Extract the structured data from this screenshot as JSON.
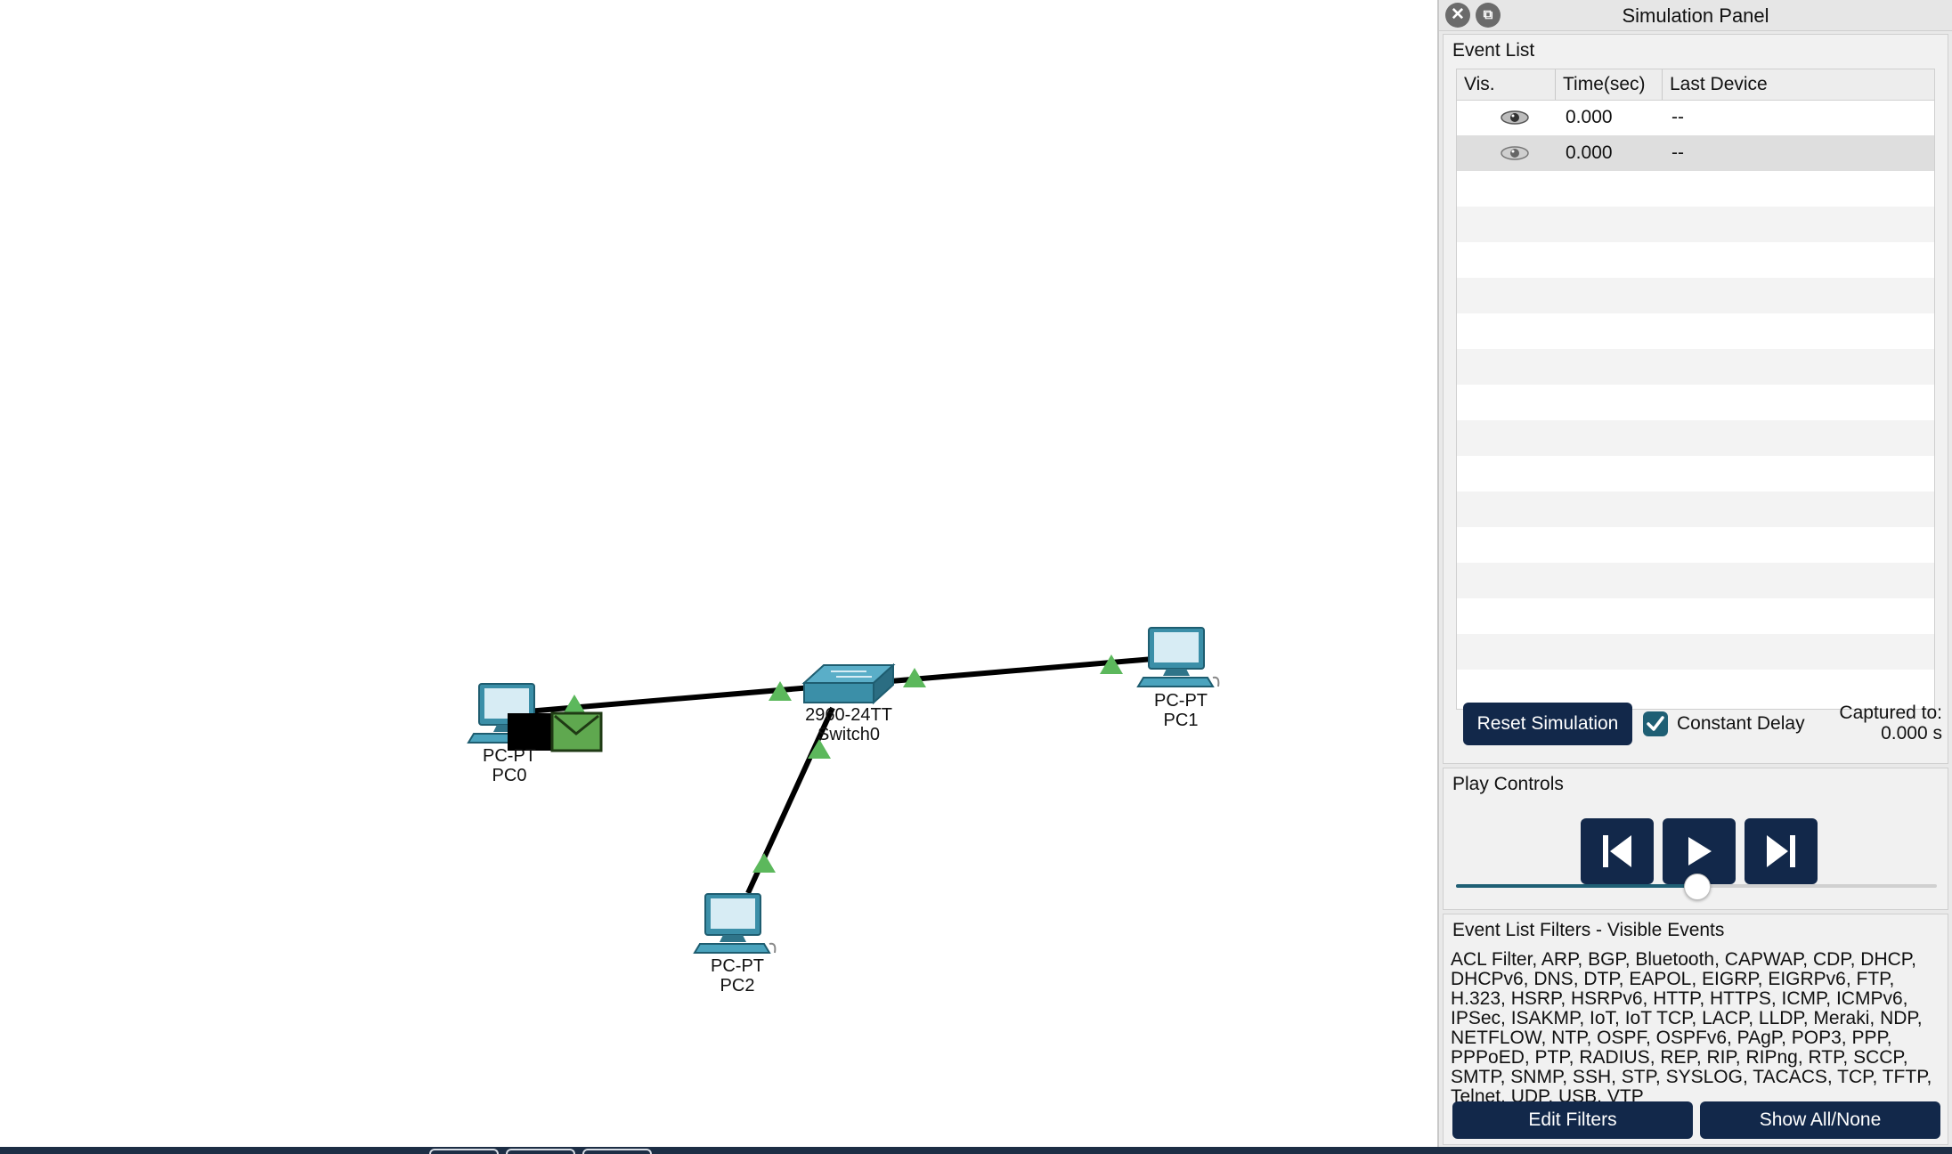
{
  "canvas": {
    "devices": [
      {
        "id": "pc0",
        "type": "PC-PT",
        "name": "PC0"
      },
      {
        "id": "pc1",
        "type": "PC-PT",
        "name": "PC1"
      },
      {
        "id": "pc2",
        "type": "PC-PT",
        "name": "PC2"
      },
      {
        "id": "switch0",
        "type": "2960-24TT",
        "name": "Switch0"
      }
    ],
    "link_status_color": "#5cb85c",
    "pdu_color": "#5fa84f"
  },
  "panel": {
    "title": "Simulation Panel",
    "event_list": {
      "title": "Event List",
      "columns": [
        "Vis.",
        "Time(sec)",
        "Last Device"
      ],
      "rows": [
        {
          "time": "0.000",
          "last_device": "--"
        },
        {
          "time": "0.000",
          "last_device": "--"
        }
      ]
    },
    "reset_label": "Reset Simulation",
    "constant_delay_label": "Constant Delay",
    "captured_label": "Captured to:",
    "captured_value": "0.000 s",
    "play_controls": {
      "title": "Play Controls",
      "slider_fraction": 0.5
    },
    "filters": {
      "title": "Event List Filters - Visible Events",
      "text": "ACL Filter, ARP, BGP, Bluetooth, CAPWAP, CDP, DHCP, DHCPv6, DNS, DTP, EAPOL, EIGRP, EIGRPv6, FTP, H.323, HSRP, HSRPv6, HTTP, HTTPS, ICMP, ICMPv6, IPSec, ISAKMP, IoT, IoT TCP, LACP, LLDP, Meraki, NDP, NETFLOW, NTP, OSPF, OSPFv6, PAgP, POP3, PPP, PPPoED, PTP, RADIUS, REP, RIP, RIPng, RTP, SCCP, SMTP, SNMP, SSH, STP, SYSLOG, TACACS, TCP, TFTP, Telnet, UDP, USB, VTP",
      "edit_label": "Edit Filters",
      "show_label": "Show All/None"
    },
    "accent_color": "#12284a"
  }
}
